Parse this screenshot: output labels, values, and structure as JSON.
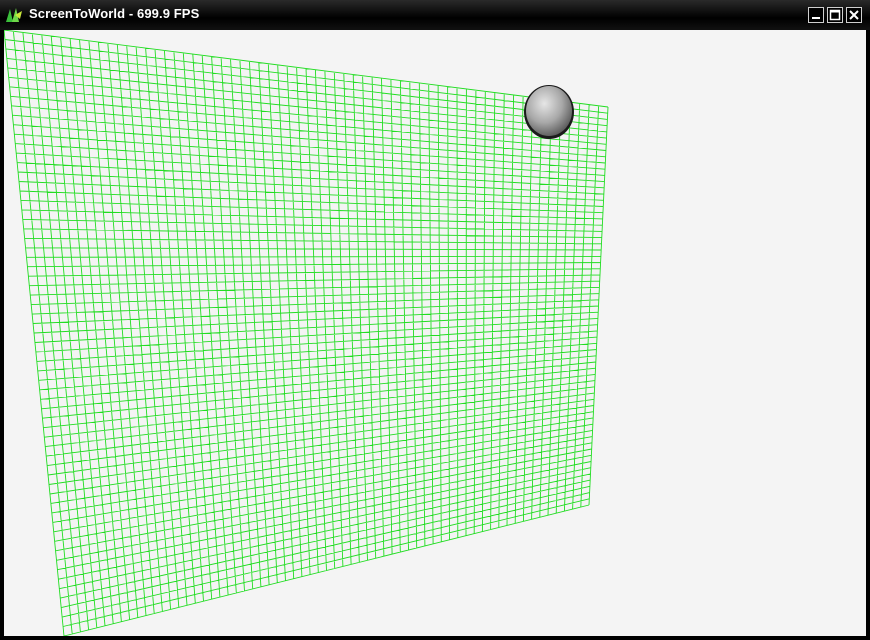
{
  "window": {
    "title": "ScreenToWorld - 699.9 FPS",
    "icon": "app-logo-icon",
    "controls": [
      "minimize-icon",
      "maximize-icon",
      "close-icon"
    ]
  },
  "scene": {
    "background_color": "#f4f4f4",
    "mesh_color": "#22dd22",
    "mesh_style": "wireframe grid plane",
    "sphere_color": "#a8a8a8"
  }
}
